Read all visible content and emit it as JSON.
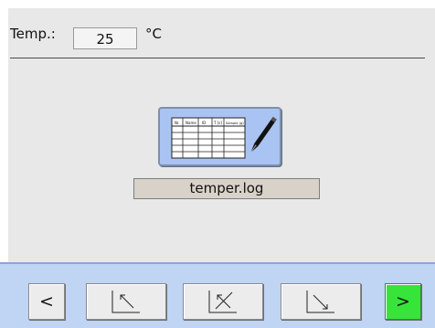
{
  "temperature": {
    "label": "Temp.:",
    "value": "25",
    "unit": "°C"
  },
  "log": {
    "icon": "log-table-pen-icon",
    "filename": "temper.log",
    "table_headers": [
      "Nr.",
      "Name",
      "ID",
      "T [s]",
      "Sample (g)"
    ]
  },
  "toolbar": {
    "back_label": "<",
    "next_label": ">",
    "icons": {
      "previous": "arrow-up-left-icon",
      "clear": "crossed-arrow-icon",
      "next": "arrow-down-right-icon"
    },
    "colors": {
      "toolbar_bg": "#c0d4f4",
      "next_button": "#36e43a"
    }
  }
}
